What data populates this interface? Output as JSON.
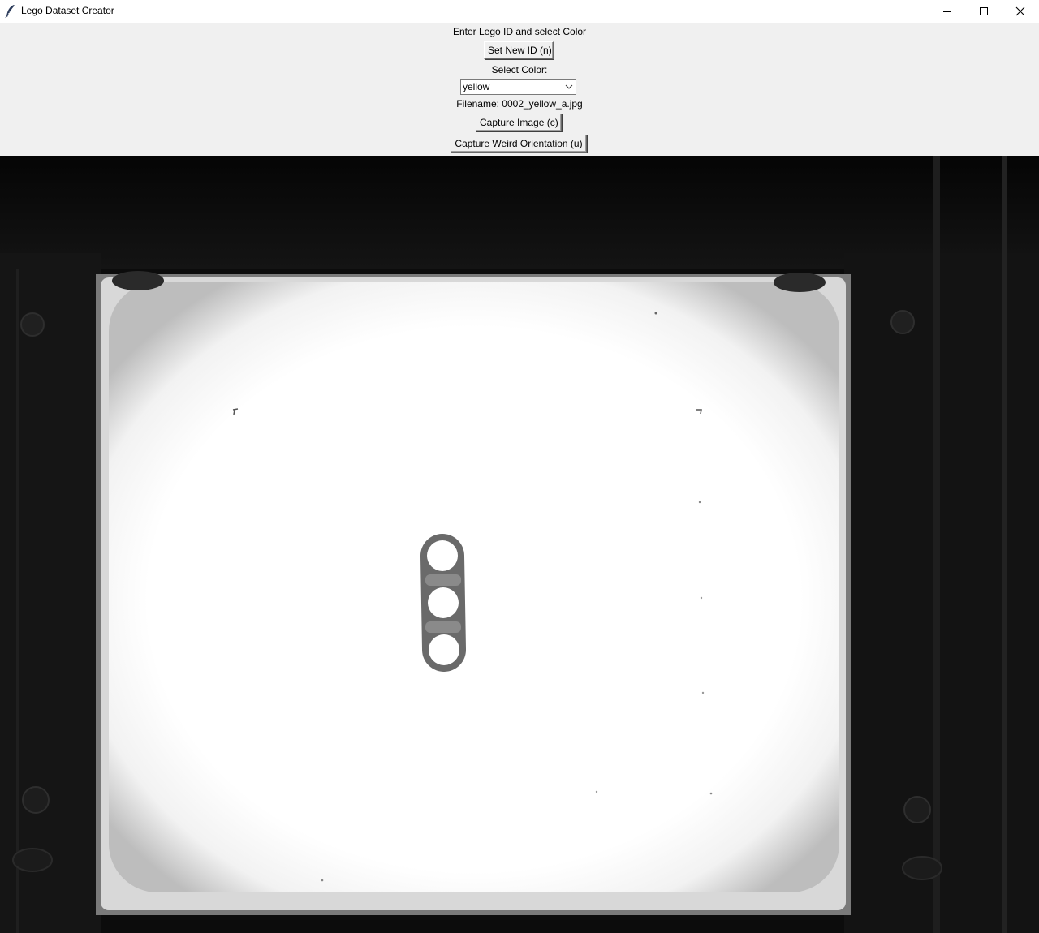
{
  "window": {
    "title": "Lego Dataset Creator",
    "app_icon": "feather-icon",
    "controls": [
      "minimize-icon",
      "maximize-icon",
      "close-icon"
    ]
  },
  "panel": {
    "instruction_label": "Enter Lego ID and select Color",
    "set_id_button": "Set New ID (n)",
    "color_label": "Select Color:",
    "color_select": {
      "selected": "yellow"
    },
    "filename_label": "Filename: 0002_yellow_a.jpg",
    "capture_button": "Capture Image (c)",
    "capture_weird_button": "Capture Weird Orientation (u)"
  },
  "camera_feed": {
    "subject": "grayscale camera view of a lego beam piece with three holes on a backlit platform"
  },
  "colors": {
    "panel_bg": "#f0f0f0",
    "titlebar_bg": "#ffffff",
    "feed_bg": "#0a0a0a",
    "lightbox": "#ffffff"
  }
}
